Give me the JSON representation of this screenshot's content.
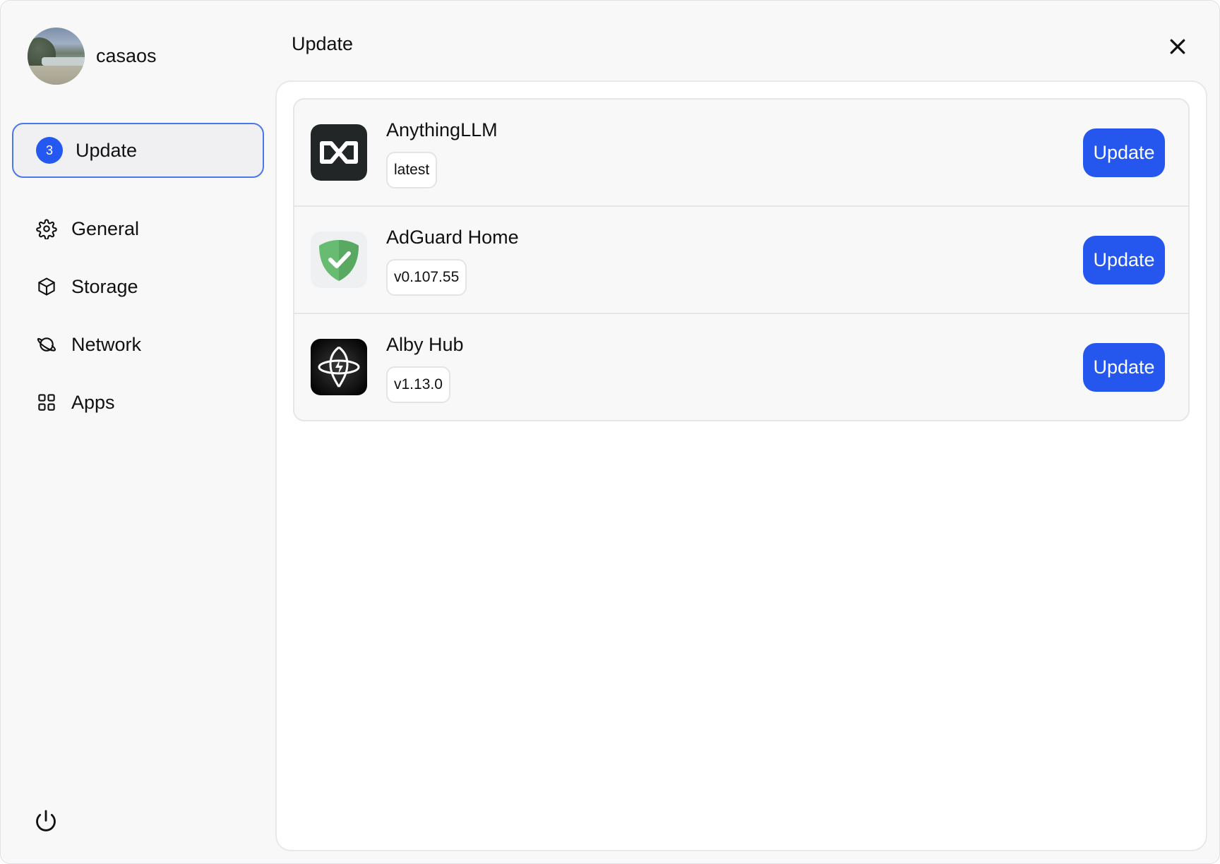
{
  "profile": {
    "name": "casaos"
  },
  "nav": {
    "update": {
      "label": "Update",
      "badge": "3"
    },
    "items": [
      {
        "label": "General",
        "icon": "gear-icon"
      },
      {
        "label": "Storage",
        "icon": "box-icon"
      },
      {
        "label": "Network",
        "icon": "planet-icon"
      },
      {
        "label": "Apps",
        "icon": "grid-icon"
      }
    ]
  },
  "main": {
    "title": "Update",
    "apps": [
      {
        "name": "AnythingLLM",
        "version": "latest",
        "button": "Update",
        "icon": "anythingllm-icon"
      },
      {
        "name": "AdGuard Home",
        "version": "v0.107.55",
        "button": "Update",
        "icon": "adguard-shield-icon"
      },
      {
        "name": "Alby Hub",
        "version": "v1.13.0",
        "button": "Update",
        "icon": "albyhub-icon"
      }
    ]
  },
  "colors": {
    "accent": "#2557EE",
    "active_border": "#4A78E8",
    "badge": "#2558F0"
  }
}
